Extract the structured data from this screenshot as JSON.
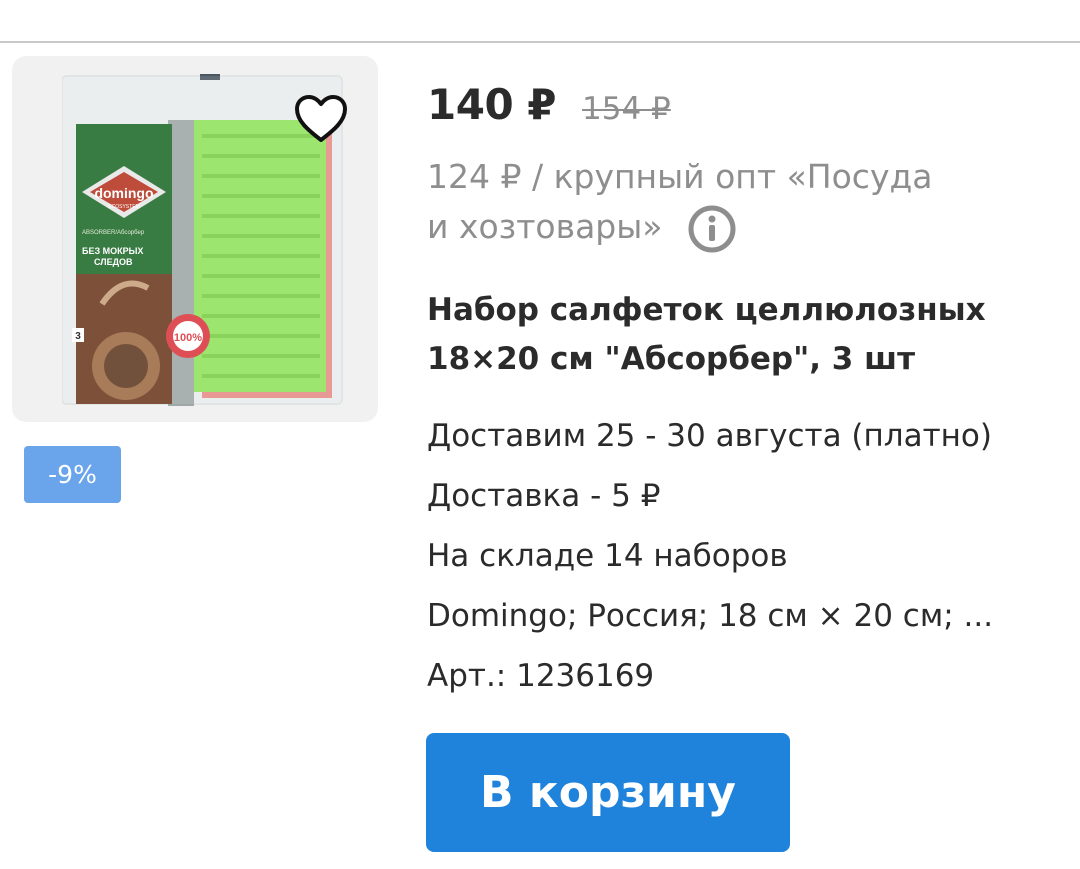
{
  "product": {
    "price_current": "140 ₽",
    "price_old": "154 ₽",
    "wholesale_line1": "124 ₽ / крупный опт «Посуда",
    "wholesale_line2": "и хозтовары»",
    "title_line1": "Набор салфеток целлюлозных",
    "title_line2": "18×20 см \"Абсорбер\", 3 шт",
    "discount_badge": "-9%",
    "details": [
      "Доставим 25 - 30 августа (платно)",
      "Доставка - 5 ₽",
      "На складе 14 наборов",
      "Domingo; Россия; 18 см × 20 см; ...",
      "Арт.: 1236169"
    ],
    "cart_button_label": "В корзину"
  },
  "packaging": {
    "brand": "domingo",
    "brand_sub": "ECOSYSTEM",
    "product_line": "ABSORBER/Абсорбер",
    "slogan_line1": "БЕЗ МОКРЫХ",
    "slogan_line2": "СЛЕДОВ",
    "count": "3",
    "seal": "100%"
  },
  "colors": {
    "accent": "#1f83dc",
    "badge": "#6aa4ea",
    "muted_text": "#8e8e8e",
    "text": "#2b2b2b"
  },
  "icons": {
    "favorite": "heart-outline-icon",
    "info": "info-circle-icon"
  }
}
